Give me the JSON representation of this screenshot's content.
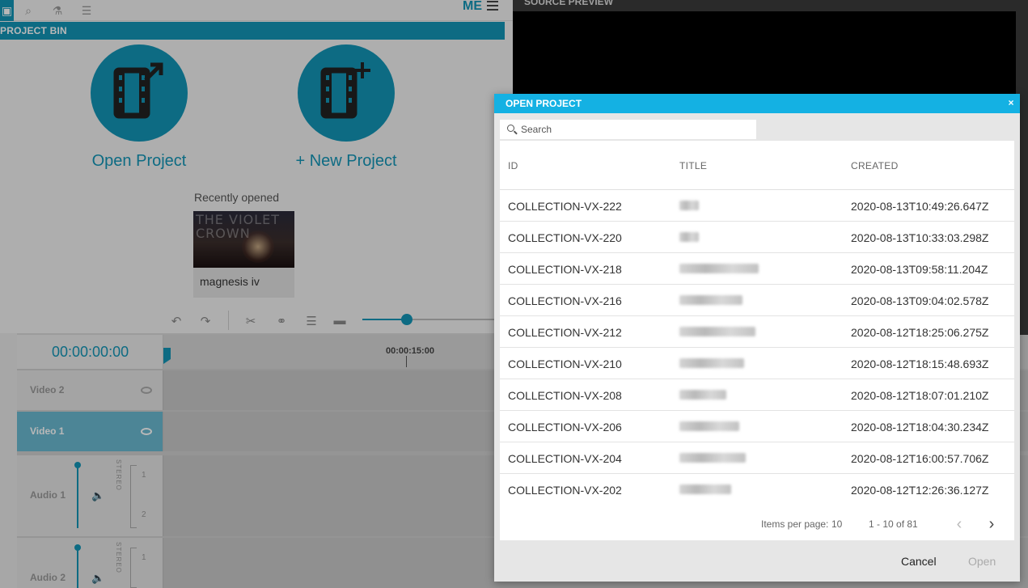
{
  "app": {
    "me_label": "ME",
    "project_bin_label": "PROJECT BIN",
    "open_project_label": "Open Project",
    "new_project_label": "+ New Project",
    "recently_opened_label": "Recently opened",
    "recent_item_title": "magnesis iv",
    "recent_thumb_text": "THE VIOLET CROWN",
    "source_preview_label": "SOURCE PREVIEW",
    "timecode": "00:00:00:00",
    "ruler_tick": "00:00:15:00",
    "tracks": {
      "video2": "Video 2",
      "video1": "Video 1",
      "audio1": "Audio 1",
      "audio2": "Audio 2",
      "stereo": "STEREO",
      "chan1": "1",
      "chan2": "2"
    },
    "accent_color": "#1295b6"
  },
  "dialog": {
    "title": "OPEN PROJECT",
    "close_glyph": "×",
    "search_placeholder": "Search",
    "columns": {
      "id": "ID",
      "title": "TITLE",
      "created": "CREATED"
    },
    "rows": [
      {
        "id": "COLLECTION-VX-222",
        "created": "2020-08-13T10:49:26.647Z"
      },
      {
        "id": "COLLECTION-VX-220",
        "created": "2020-08-13T10:33:03.298Z"
      },
      {
        "id": "COLLECTION-VX-218",
        "created": "2020-08-13T09:58:11.204Z"
      },
      {
        "id": "COLLECTION-VX-216",
        "created": "2020-08-13T09:04:02.578Z"
      },
      {
        "id": "COLLECTION-VX-212",
        "created": "2020-08-12T18:25:06.275Z"
      },
      {
        "id": "COLLECTION-VX-210",
        "created": "2020-08-12T18:15:48.693Z"
      },
      {
        "id": "COLLECTION-VX-208",
        "created": "2020-08-12T18:07:01.210Z"
      },
      {
        "id": "COLLECTION-VX-206",
        "created": "2020-08-12T18:04:30.234Z"
      },
      {
        "id": "COLLECTION-VX-204",
        "created": "2020-08-12T16:00:57.706Z"
      },
      {
        "id": "COLLECTION-VX-202",
        "created": "2020-08-12T12:26:36.127Z"
      }
    ],
    "items_per_page_label": "Items per page:",
    "items_per_page_value": "10",
    "range_label": "1 - 10 of 81",
    "prev_glyph": "‹",
    "next_glyph": "›",
    "cancel_label": "Cancel",
    "open_label": "Open",
    "header_color": "#14b1e3"
  }
}
